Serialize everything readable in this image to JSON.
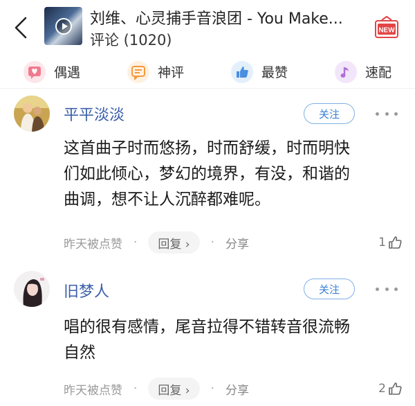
{
  "header": {
    "title": "刘维、心灵捕手音浪团 - You Make...",
    "subtitle": "评论 (1020)",
    "new_badge": "NEW"
  },
  "tabs": [
    {
      "label": "偶遇",
      "icon": "heart-chat-icon",
      "color": "#f07a8e",
      "bg": "#fde6ea"
    },
    {
      "label": "神评",
      "icon": "message-icon",
      "color": "#f59a3c",
      "bg": "#fff1e2"
    },
    {
      "label": "最赞",
      "icon": "thumbs-up-icon",
      "color": "#4a8fe0",
      "bg": "#e3f0fc"
    },
    {
      "label": "速配",
      "icon": "music-note-icon",
      "color": "#b070d8",
      "bg": "#f2e6fa"
    }
  ],
  "comments": [
    {
      "username": "平平淡淡",
      "follow_label": "关注",
      "text_lines": [
        "这首曲子时而悠扬，时而舒缓，时而明快",
        "们如此倾心，梦幻的境界，有没，和谐的",
        "曲调，想不让人沉醉都难呢。"
      ],
      "time": "昨天被点赞",
      "reply_label": "回复 ›",
      "share_label": "分享",
      "likes": "1"
    },
    {
      "username": "旧梦人",
      "follow_label": "关注",
      "text_lines": [
        "唱的很有感情，尾音拉得不错转音很流畅",
        "自然"
      ],
      "time": "昨天被点赞",
      "reply_label": "回复 ›",
      "share_label": "分享",
      "likes": "2"
    }
  ],
  "colors": {
    "username": "#3a5ea8",
    "follow": "#3a7fd5"
  }
}
